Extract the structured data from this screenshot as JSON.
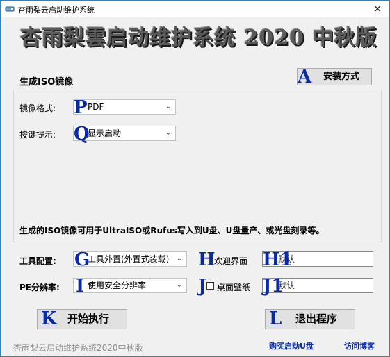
{
  "window": {
    "title": "杏雨梨云启动维护系统",
    "close_glyph": "✕"
  },
  "banner": {
    "text": "杏雨梨雲启动维护系统 2020 中秋版"
  },
  "iso": {
    "section_title": "生成ISO镜像",
    "format": {
      "label": "镜像格式:",
      "badge": "P",
      "value": "PDF"
    },
    "key_hint": {
      "label": "按键提示:",
      "badge": "Q",
      "value": "显示启动"
    },
    "info_text": "生成的ISO镜像可用于UltraISO或Rufus写入到U盘、U盘量产、或光盘刻录等。"
  },
  "install_button": {
    "badge": "A",
    "label": "安装方式"
  },
  "tools": {
    "label": "工具配置:",
    "badge": "G",
    "value": "工具外置(外置式装载)",
    "welcome": {
      "badge": "H",
      "label": "欢迎界面",
      "input_badge": "H1",
      "input_value": "默认"
    }
  },
  "resolution": {
    "label": "PE分辨率:",
    "badge": "I",
    "value": "使用安全分辨率",
    "wallpaper": {
      "badge": "J",
      "label": "桌面壁纸",
      "input_badge": "J1",
      "input_value": "默认"
    }
  },
  "start_button": {
    "badge": "K",
    "label": "开始执行"
  },
  "exit_button": {
    "badge": "L",
    "label": "退出程序"
  },
  "footer": {
    "app_title": "杏雨梨云启动维护系统2020中秋版",
    "buy_link": "购买启动U盘",
    "blog_link": "访问博客"
  },
  "icons": {
    "app": "usb-drive-icon",
    "close": "close-icon",
    "dropdown": "chevron-down-icon"
  },
  "colors": {
    "badge_blue": "#0a2aa0",
    "link_blue": "#0b2fa8",
    "window_border": "#3c7fb1"
  }
}
